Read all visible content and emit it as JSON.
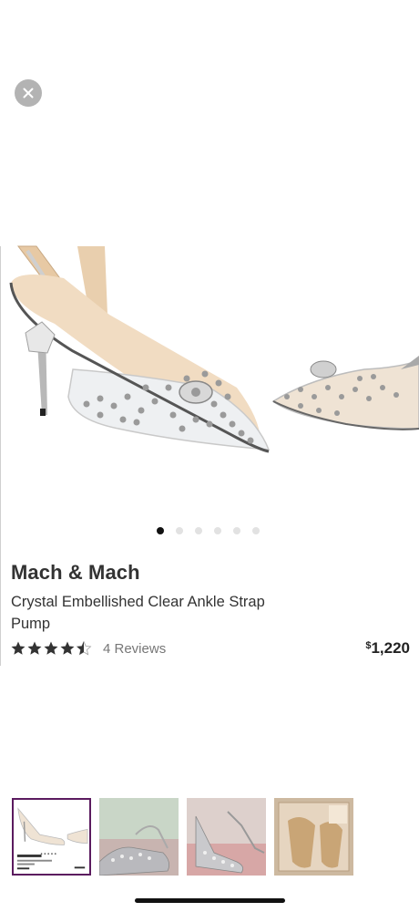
{
  "close": {
    "icon": "close-icon"
  },
  "carousel": {
    "total_images": 6,
    "active_index": 0
  },
  "product": {
    "brand": "Mach & Mach",
    "title": "Crystal Embellished Clear Ankle Strap Pump",
    "rating": 4.5,
    "reviews_label": "4 Reviews",
    "price_currency": "$",
    "price_amount": "1,220"
  },
  "thumbnails": [
    {
      "name": "thumb-product-card",
      "selected": true
    },
    {
      "name": "thumb-photo-2",
      "selected": false
    },
    {
      "name": "thumb-photo-3",
      "selected": false
    },
    {
      "name": "thumb-photo-4",
      "selected": false
    }
  ],
  "colors": {
    "thumbnail_border": "#5b1b5f",
    "active_dot": "#111111",
    "inactive_dot": "#e2e2e2"
  }
}
